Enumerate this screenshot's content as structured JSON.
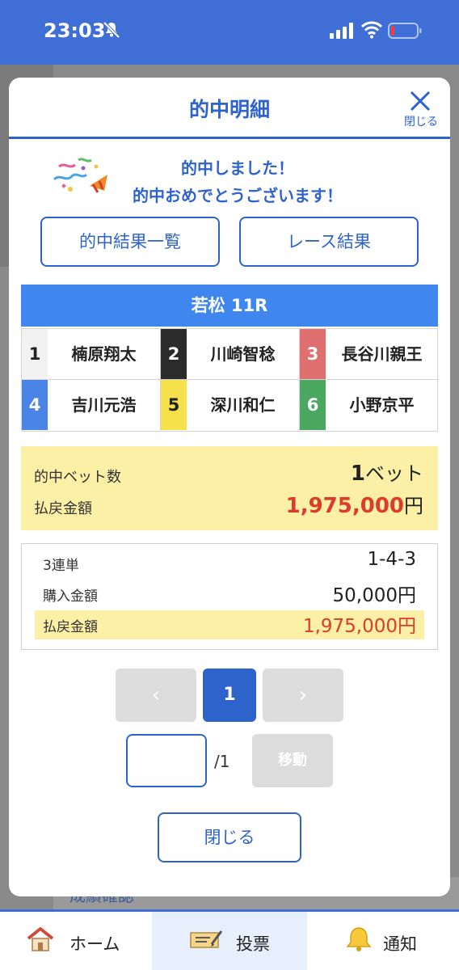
{
  "status": {
    "time": "23:03"
  },
  "background": {
    "partial_text": "成績確認"
  },
  "modal": {
    "title": "的中明細",
    "close_x_label": "閉じる",
    "congrats_line1": "的中しました！",
    "congrats_line2": "的中おめでとうございます！",
    "btn_hit_results": "的中結果一覧",
    "btn_race_results": "レース結果",
    "race": "若松 11R",
    "racers": [
      {
        "num": "1",
        "name": "楠原翔太",
        "color": "#f2f2f2",
        "text_color": "#222222"
      },
      {
        "num": "2",
        "name": "川崎智稔",
        "color": "#2b2b2b",
        "text_color": "#ffffff"
      },
      {
        "num": "3",
        "name": "長谷川親王",
        "color": "#e07070",
        "text_color": "#ffffff"
      },
      {
        "num": "4",
        "name": "吉川元浩",
        "color": "#4a84e6",
        "text_color": "#ffffff"
      },
      {
        "num": "5",
        "name": "深川和仁",
        "color": "#f6e04c",
        "text_color": "#222222"
      },
      {
        "num": "6",
        "name": "小野京平",
        "color": "#4aa860",
        "text_color": "#ffffff"
      }
    ],
    "summary": {
      "hit_bets_label": "的中ベット数",
      "hit_bets_count": "1",
      "hit_bets_unit": "ベット",
      "payout_label": "払戻金額",
      "payout_value": "1,975,000",
      "payout_unit": "円"
    },
    "bet_detail": {
      "bet_type": "3連単",
      "combination": "1-4-3",
      "purchase_label": "購入金額",
      "purchase_value": "50,000円",
      "payout_label": "払戻金額",
      "payout_value": "1,975,000円"
    },
    "pagination": {
      "prev": "‹",
      "current": "1",
      "next": "›",
      "total": "/1",
      "move_label": "移動"
    },
    "close_button": "閉じる"
  },
  "bottom_nav": {
    "home": "ホーム",
    "vote": "投票",
    "notice": "通知"
  },
  "colors": {
    "accent": "#2f63cc",
    "race_header": "#3f86ee",
    "highlight": "#fbf0a6",
    "payout_red": "#dc3b2e"
  }
}
